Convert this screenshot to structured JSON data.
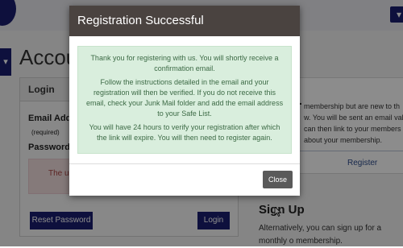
{
  "header": {
    "menu_glyph": "▾"
  },
  "page": {
    "title": "Accou"
  },
  "login_panel": {
    "heading": "Login",
    "email_label": "Email Addres",
    "required_note": "(required)",
    "password_label": "Password",
    "password_note_tail": "(r",
    "error_text": "The use",
    "reset_button": "Reset Password",
    "login_button": "Login"
  },
  "right_panel": {
    "heading_fragment": ".",
    "lines": [
      "membership but are new to th",
      "w. You will be sent an email valid",
      "can then link to your members",
      "about your membership."
    ],
    "register_link": "Register"
  },
  "signup": {
    "title": "Sign Up",
    "text": "Alternatively, you can sign up for a monthly o membership."
  },
  "modal": {
    "title": "Registration Successful",
    "messages": [
      "Thank you for registering with us. You will shortly receive a confirmation email.",
      "Follow the instructions detailed in the email and your registration will then be verified. If you do not receive this email, check your Junk Mail folder and add the email address to your Safe List.",
      "You will have 24 hours to verify your registration after which the link will expire. You will then need to register again."
    ],
    "close_button": "Close"
  },
  "colors": {
    "brand": "#1b1e6f",
    "modal_header": "#4a4340",
    "alert_bg": "#d9eedd",
    "alert_text": "#3c6a45",
    "error_bg": "#f2dede"
  }
}
